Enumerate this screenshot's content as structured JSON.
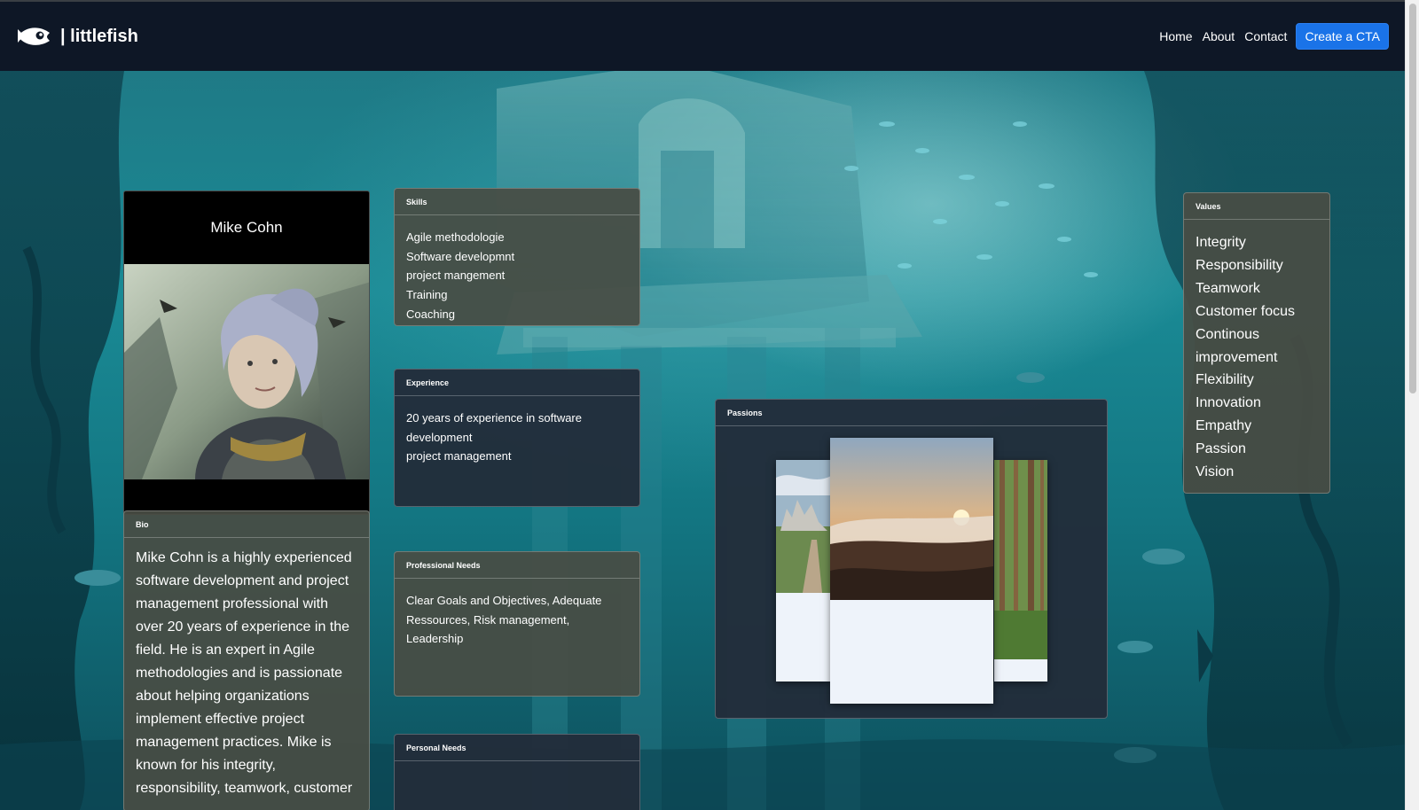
{
  "brand": {
    "name": "| littlefish",
    "logo_icon": "fish-logo-icon"
  },
  "nav": {
    "links": [
      "Home",
      "About",
      "Contact"
    ],
    "cta": "Create a CTA"
  },
  "profile": {
    "name": "Mike Cohn"
  },
  "bio": {
    "title": "Bio",
    "text": "Mike Cohn is a highly experienced software development and project management professional with over 20 years of experience in the field. He is an expert in Agile methodologies and is passionate about helping organizations implement effective project management practices. Mike is known for his integrity, responsibility, teamwork, customer"
  },
  "skills": {
    "title": "Skills",
    "items": [
      "Agile methodologie",
      "Software developmnt",
      "project mangement",
      "Training",
      "Coaching"
    ]
  },
  "experience": {
    "title": "Experience",
    "lines": [
      "20 years of experience in software development",
      "project management"
    ]
  },
  "professional_needs": {
    "title": "Professional Needs",
    "text": "Clear Goals and Objectives, Adequate Ressources, Risk management, Leadership"
  },
  "personal_needs": {
    "title": "Personal Needs"
  },
  "passions": {
    "title": "Passions"
  },
  "values": {
    "title": "Values",
    "items": [
      "Integrity",
      "Responsibility",
      "Teamwork",
      "Customer focus",
      "Continous improvement",
      "Flexibility",
      "Innovation",
      "Empathy",
      "Passion",
      "Vision"
    ]
  },
  "colors": {
    "navbar": "#0e1726",
    "cta": "#1a73e8",
    "card_dark": "#222d3a",
    "card_olive": "#484c44"
  }
}
